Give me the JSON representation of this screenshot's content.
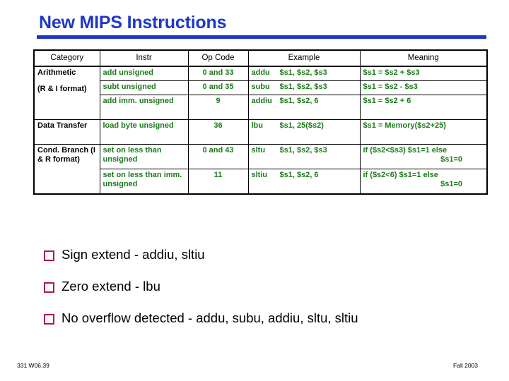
{
  "slide": {
    "title": "New MIPS Instructions",
    "title_color": "#1f36c7",
    "accent_color": "#1f36c7",
    "data_text_color": "#1b7a1b",
    "bullet_color": "#b01b43"
  },
  "table": {
    "headers": [
      "Category",
      "Instr",
      "Op Code",
      "Example",
      "Meaning"
    ],
    "rows": [
      {
        "category": "Arithmetic",
        "category_sub": "",
        "instr": "add unsigned",
        "opcode": "0 and 33",
        "example_mnemonic": "addu",
        "example_operands": "$s1, $s2, $s3",
        "meaning": "$s1 = $s2 + $s3",
        "meaning_line2": ""
      },
      {
        "category": "",
        "category_sub": "(R & I format)",
        "instr": "subt unsigned",
        "opcode": "0 and 35",
        "example_mnemonic": "subu",
        "example_operands": "$s1, $s2, $s3",
        "meaning": "$s1 = $s2 - $s3",
        "meaning_line2": ""
      },
      {
        "category": "",
        "category_sub": "",
        "instr": "add imm. unsigned",
        "opcode": "9",
        "example_mnemonic": "addiu",
        "example_operands": "$s1, $s2, 6",
        "meaning": "$s1 = $s2 + 6",
        "meaning_line2": ""
      },
      {
        "category": "Data Transfer",
        "category_sub": "",
        "instr": "load byte unsigned",
        "opcode": "36",
        "example_mnemonic": "lbu",
        "example_operands": "$s1, 25($s2)",
        "meaning": "$s1 = Memory($s2+25)",
        "meaning_line2": ""
      },
      {
        "category": "Cond. Branch   (I & R format)",
        "category_sub": "",
        "instr": "set on less than unsigned",
        "opcode": "0 and 43",
        "example_mnemonic": "sltu",
        "example_operands": "$s1, $s2, $s3",
        "meaning": "if ($s2<$s3) $s1=1 else",
        "meaning_line2": "$s1=0"
      },
      {
        "category": "",
        "category_sub": "",
        "instr": "set on less than imm. unsigned",
        "opcode": "11",
        "example_mnemonic": "sltiu",
        "example_operands": "$s1, $s2, 6",
        "meaning": "if ($s2<6) $s1=1 else",
        "meaning_line2": "$s1=0"
      }
    ]
  },
  "bullets": [
    {
      "text": "Sign extend - addiu, sltiu"
    },
    {
      "text": "Zero extend - lbu"
    },
    {
      "text": "No overflow detected - addu, subu, addiu, sltu, sltiu"
    }
  ],
  "footer": {
    "left": "331 W06.39",
    "right": "Fall 2003"
  }
}
